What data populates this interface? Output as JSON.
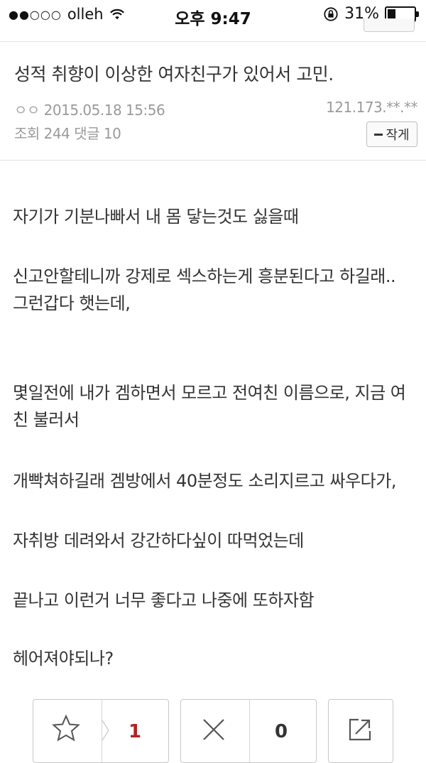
{
  "status_bar": {
    "signal": "●●○○○",
    "carrier": "olleh",
    "time": "오후 9:47",
    "battery_percent_text": "31%",
    "battery_level": 0.31
  },
  "post": {
    "title": "성적 취향이 이상한 여자친구가 있어서 고민.",
    "author": "ㅇㅇ",
    "datetime": "2015.05.18 15:56",
    "ip": "121.173.**.**",
    "views_label": "조회",
    "views": "244",
    "comments_label": "댓글",
    "comments": "10",
    "write_label": "작게"
  },
  "body": {
    "paragraphs": [
      [
        "자기가 기분나빠서 내 몸 닿는것도 싫을때"
      ],
      [
        "신고안할테니까 강제로 섹스하는게 흥분된다고 하길래..",
        "그런갑다 햇는데,"
      ],
      [
        "몇일전에 내가 겜하면서 모르고 전여친 이름으로, 지금 여",
        "친 불러서"
      ],
      [
        "개빡쳐하길래 겜방에서 40분정도 소리지르고 싸우다가,"
      ],
      [
        "자취방 데려와서 강간하다싶이 따먹었는데"
      ],
      [
        "끝나고 이런거 너무 좋다고 나중에 또하자함"
      ],
      [
        "헤어져야되나?"
      ]
    ]
  },
  "actions": {
    "recommend_count": "1",
    "dislike_count": "0"
  },
  "colors": {
    "text": "#333333",
    "meta": "#9a9a9a",
    "recommend_count": "#b22222",
    "border": "#c8c8c8"
  }
}
